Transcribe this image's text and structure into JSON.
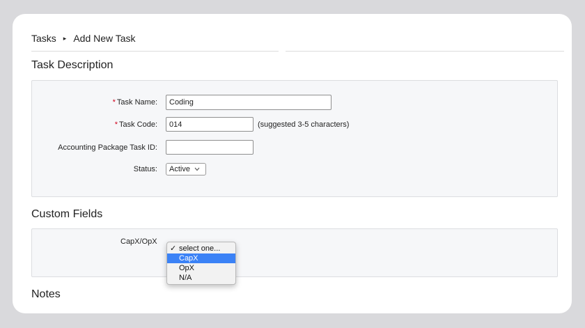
{
  "breadcrumb": {
    "parent": "Tasks",
    "separator": "▸",
    "current": "Add New Task"
  },
  "task_description": {
    "title": "Task Description",
    "task_name": {
      "label": "Task Name:",
      "value": "Coding",
      "required": true
    },
    "task_code": {
      "label": "Task Code:",
      "value": "014",
      "required": true,
      "hint": "(suggested 3-5 characters)"
    },
    "accounting_id": {
      "label": "Accounting Package Task ID:",
      "value": ""
    },
    "status": {
      "label": "Status:",
      "value": "Active"
    },
    "required_marker": "*"
  },
  "custom_fields": {
    "title": "Custom Fields",
    "capx_opx": {
      "label": "CapX/OpX",
      "options": [
        {
          "label": "select one...",
          "checked": true,
          "highlighted": false
        },
        {
          "label": "CapX",
          "checked": false,
          "highlighted": true
        },
        {
          "label": "OpX",
          "checked": false,
          "highlighted": false
        },
        {
          "label": "N/A",
          "checked": false,
          "highlighted": false
        }
      ],
      "check_glyph": "✓"
    }
  },
  "notes": {
    "title": "Notes"
  },
  "colors": {
    "required": "#d0021b",
    "highlight": "#3b82f6",
    "panel_bg": "#f6f7f9"
  }
}
